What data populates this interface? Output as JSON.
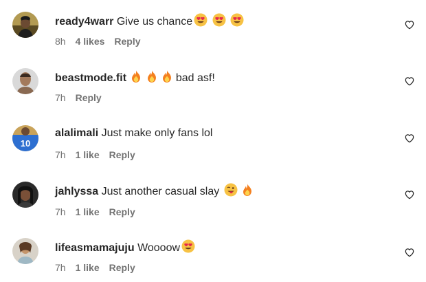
{
  "comments": [
    {
      "username": "ready4warr",
      "text": "Give us chance",
      "emoji": [
        "smiling-face-with-heart-eyes",
        "smiling-face-with-heart-eyes",
        "smiling-face-with-heart-eyes"
      ],
      "time": "8h",
      "likes": "4 likes",
      "reply": "Reply"
    },
    {
      "username": "beastmode.fit",
      "text": "bad asf!",
      "emoji_before_text": [
        "fire",
        "fire",
        "fire"
      ],
      "time": "7h",
      "likes": "",
      "reply": "Reply"
    },
    {
      "username": "alalimali",
      "text": "Just make only fans lol",
      "time": "7h",
      "likes": "1 like",
      "reply": "Reply"
    },
    {
      "username": "jahlyssa",
      "text": "Just another casual slay",
      "emoji": [
        "winking-face-with-tongue",
        "fire"
      ],
      "time": "7h",
      "likes": "1 like",
      "reply": "Reply"
    },
    {
      "username": "lifeasmamajuju",
      "text": "Woooow",
      "emoji": [
        "smiling-face-with-heart-eyes"
      ],
      "time": "7h",
      "likes": "1 like",
      "reply": "Reply"
    }
  ],
  "colors": {
    "text": "#262626",
    "secondary": "#737373",
    "heart_outline": "#262626"
  }
}
